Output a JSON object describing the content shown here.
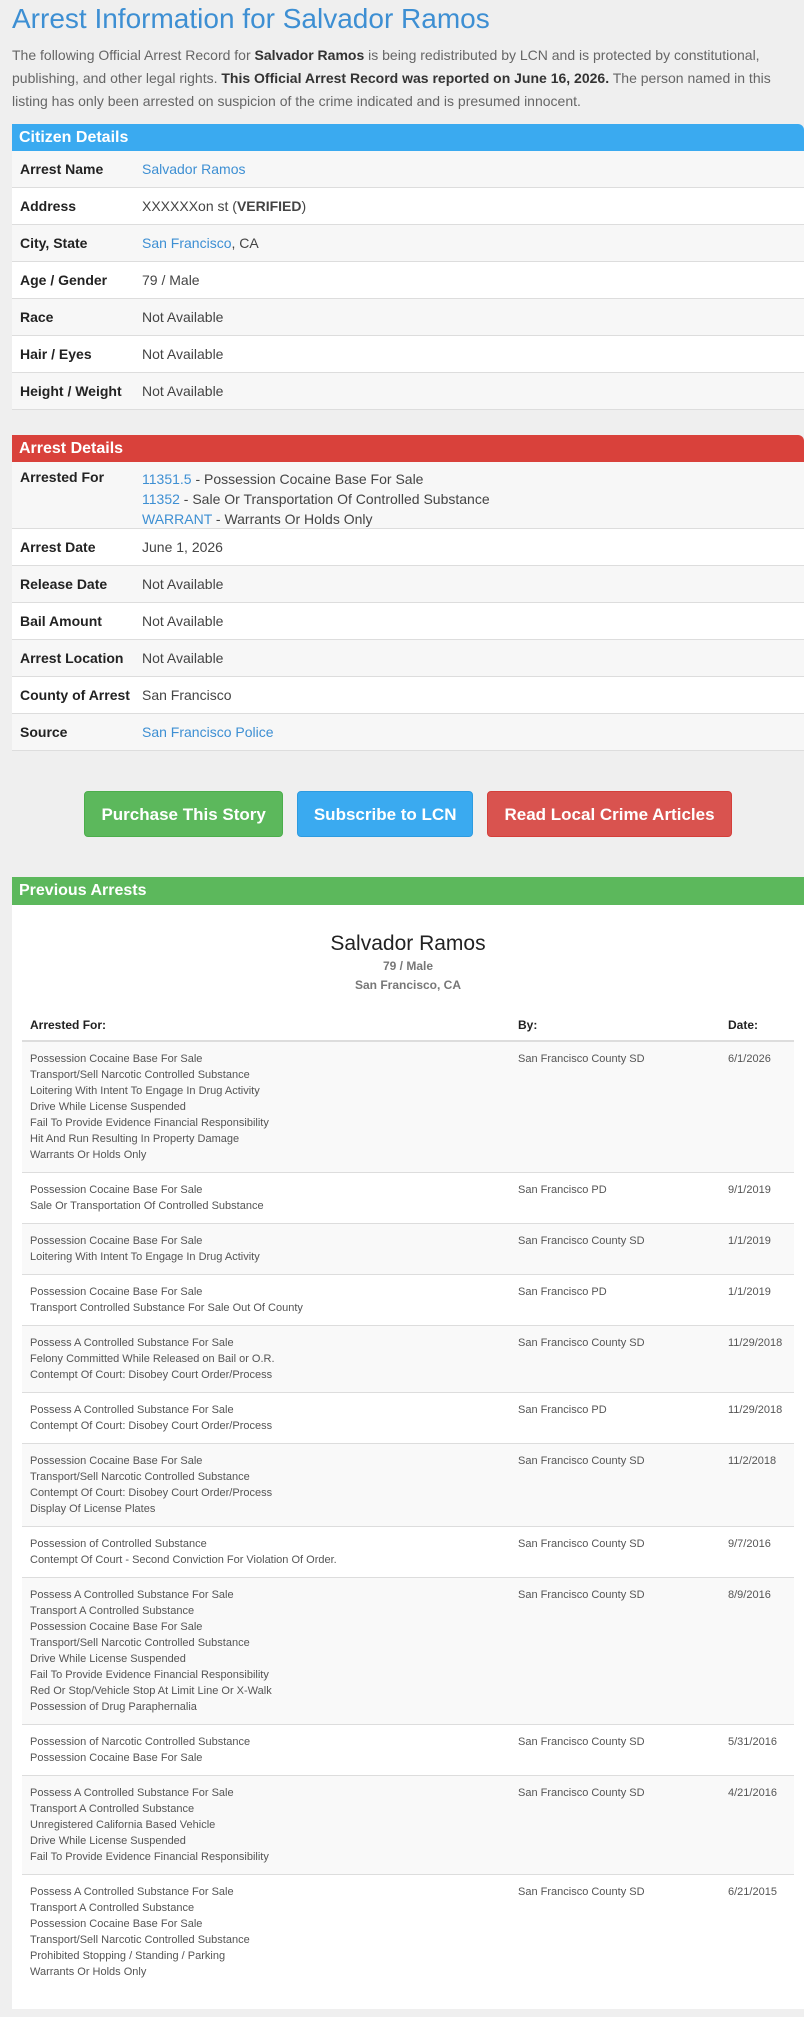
{
  "title": "Arrest Information for Salvador Ramos",
  "intro": {
    "part1": "The following Official Arrest Record for ",
    "name": "Salvador Ramos",
    "part2": " is being redistributed by LCN and is protected by constitutional, publishing, and other legal rights. ",
    "reported": "This Official Arrest Record was reported on June 16, 2026.",
    "part3": " The person named in this listing has only been arrested on suspicion of the crime indicated and is presumed innocent."
  },
  "citizen": {
    "header": "Citizen Details",
    "arrest_name_label": "Arrest Name",
    "arrest_name": "Salvador Ramos",
    "address_label": "Address",
    "address": "XXXXXXon st (",
    "address_verified": "VERIFIED",
    "address_close": ")",
    "city_label": "City, State",
    "city": "San Francisco",
    "state": ", CA",
    "age_label": "Age / Gender",
    "age": "79 / Male",
    "race_label": "Race",
    "race": "Not Available",
    "hair_label": "Hair / Eyes",
    "hair": "Not Available",
    "height_label": "Height / Weight",
    "height": "Not Available"
  },
  "arrest": {
    "header": "Arrest Details",
    "arrested_for_label": "Arrested For",
    "charges": [
      {
        "code": "11351.5",
        "desc": " - Possession Cocaine Base For Sale"
      },
      {
        "code": "11352",
        "desc": " - Sale Or Transportation Of Controlled Substance"
      },
      {
        "code": "WARRANT",
        "desc": " - Warrants Or Holds Only"
      }
    ],
    "arrest_date_label": "Arrest Date",
    "arrest_date": "June 1, 2026",
    "release_label": "Release Date",
    "release": "Not Available",
    "bail_label": "Bail Amount",
    "bail": "Not Available",
    "location_label": "Arrest Location",
    "location": "Not Available",
    "county_label": "County of Arrest",
    "county": "San Francisco",
    "source_label": "Source",
    "source": "San Francisco Police"
  },
  "buttons": {
    "purchase": "Purchase This Story",
    "subscribe": "Subscribe to LCN",
    "read": "Read Local Crime Articles"
  },
  "previous": {
    "header": "Previous Arrests",
    "name": "Salvador Ramos",
    "age_gender": "79 / Male",
    "location": "San Francisco, CA",
    "col_arrested_for": "Arrested For:",
    "col_by": "By:",
    "col_date": "Date:",
    "rows": [
      {
        "charges": [
          "Possession Cocaine Base For Sale",
          "Transport/Sell Narcotic Controlled Substance",
          "Loitering With Intent To Engage In Drug Activity",
          "Drive While License Suspended",
          "Fail To Provide Evidence Financial Responsibility",
          "Hit And Run Resulting In Property Damage",
          "Warrants Or Holds Only"
        ],
        "by": "San Francisco County SD",
        "date": "6/1/2026"
      },
      {
        "charges": [
          "Possession Cocaine Base For Sale",
          "Sale Or Transportation Of Controlled Substance"
        ],
        "by": "San Francisco PD",
        "date": "9/1/2019"
      },
      {
        "charges": [
          "Possession Cocaine Base For Sale",
          "Loitering With Intent To Engage In Drug Activity"
        ],
        "by": "San Francisco County SD",
        "date": "1/1/2019"
      },
      {
        "charges": [
          "Possession Cocaine Base For Sale",
          "Transport Controlled Substance For Sale Out Of County"
        ],
        "by": "San Francisco PD",
        "date": "1/1/2019"
      },
      {
        "charges": [
          "Possess A Controlled Substance For Sale",
          "Felony Committed While Released on Bail or O.R.",
          "Contempt Of Court: Disobey Court Order/Process"
        ],
        "by": "San Francisco County SD",
        "date": "11/29/2018"
      },
      {
        "charges": [
          "Possess A Controlled Substance For Sale",
          "Contempt Of Court: Disobey Court Order/Process"
        ],
        "by": "San Francisco PD",
        "date": "11/29/2018"
      },
      {
        "charges": [
          "Possession Cocaine Base For Sale",
          "Transport/Sell Narcotic Controlled Substance",
          "Contempt Of Court: Disobey Court Order/Process",
          "Display Of License Plates"
        ],
        "by": "San Francisco County SD",
        "date": "11/2/2018"
      },
      {
        "charges": [
          "Possession of Controlled Substance",
          "Contempt Of Court - Second Conviction For Violation Of Order."
        ],
        "by": "San Francisco County SD",
        "date": "9/7/2016"
      },
      {
        "charges": [
          "Possess A Controlled Substance For Sale",
          "Transport A Controlled Substance",
          "Possession Cocaine Base For Sale",
          "Transport/Sell Narcotic Controlled Substance",
          "Drive While License Suspended",
          "Fail To Provide Evidence Financial Responsibility",
          "Red Or Stop/Vehicle Stop At Limit Line Or X-Walk",
          "Possession of Drug Paraphernalia"
        ],
        "by": "San Francisco County SD",
        "date": "8/9/2016"
      },
      {
        "charges": [
          "Possession of Narcotic Controlled Substance",
          "Possession Cocaine Base For Sale"
        ],
        "by": "San Francisco County SD",
        "date": "5/31/2016"
      },
      {
        "charges": [
          "Possess A Controlled Substance For Sale",
          "Transport A Controlled Substance",
          "Unregistered California Based Vehicle",
          "Drive While License Suspended",
          "Fail To Provide Evidence Financial Responsibility"
        ],
        "by": "San Francisco County SD",
        "date": "4/21/2016"
      },
      {
        "charges": [
          "Possess A Controlled Substance For Sale",
          "Transport A Controlled Substance",
          "Possession Cocaine Base For Sale",
          "Transport/Sell Narcotic Controlled Substance",
          "Prohibited Stopping / Standing / Parking",
          "Warrants Or Holds Only"
        ],
        "by": "San Francisco County SD",
        "date": "6/21/2015"
      }
    ]
  },
  "colors": {
    "title_blue": "#3d8fd3",
    "citizen_header": "#3aaaf0",
    "arrest_header": "#d9413b",
    "previous_header": "#5cb85c",
    "btn_green": "#5cb85c",
    "btn_blue": "#3aaaf0",
    "btn_red": "#d9534f"
  }
}
